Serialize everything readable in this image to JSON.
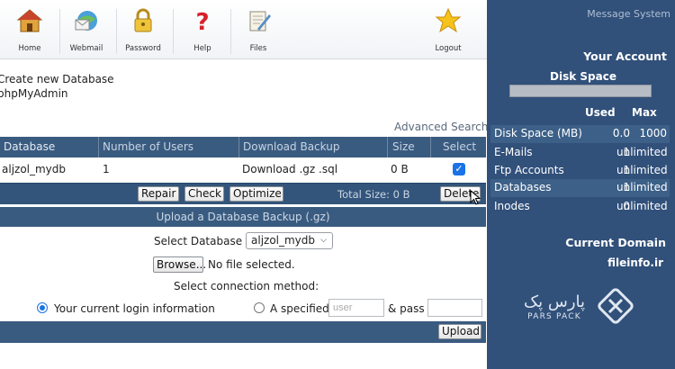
{
  "toolbar": {
    "items": [
      {
        "label": "Home",
        "icon": "home-icon"
      },
      {
        "label": "Webmail",
        "icon": "webmail-icon"
      },
      {
        "label": "Password",
        "icon": "lock-icon"
      },
      {
        "label": "Help",
        "icon": "help-icon"
      },
      {
        "label": "Files",
        "icon": "files-icon"
      },
      {
        "label": "Logout",
        "icon": "star-icon"
      }
    ]
  },
  "links": {
    "create_db": "Create new Database",
    "phpmyadmin": "phpMyAdmin",
    "advanced_search": "Advanced Search"
  },
  "table": {
    "headers": [
      "Database",
      "Number of Users",
      "Download Backup",
      "Size",
      "Select"
    ],
    "rows": [
      {
        "database": "aljzol_mydb",
        "users": "1",
        "download": "Download .gz .sql",
        "size": "0 B",
        "selected": true
      }
    ]
  },
  "actions": {
    "repair": "Repair",
    "check": "Check",
    "optimize": "Optimize",
    "total_size": "Total Size: 0 B",
    "delete": "Delete"
  },
  "upload": {
    "title": "Upload a Database Backup (.gz)",
    "select_db_label": "Select Database",
    "select_db_value": "aljzol_mydb",
    "browse": "Browse...",
    "no_file": "No file selected.",
    "method_label": "Select connection method:",
    "current_login": "Your current login information",
    "specified": "A specified",
    "user_placeholder": "user",
    "pass_label": "& pass",
    "submit": "Upload"
  },
  "panel": {
    "message_system": "Message System",
    "your_account": "Your Account",
    "disk_space": "Disk Space",
    "disk_fill": 0.0,
    "col_used": "Used",
    "col_max": "Max",
    "stats": [
      {
        "label": "Disk Space (MB)",
        "used": "0.0",
        "max": "1000"
      },
      {
        "label": "E-Mails",
        "used": "1",
        "max": "unlimited"
      },
      {
        "label": "Ftp Accounts",
        "used": "1",
        "max": "unlimited"
      },
      {
        "label": "Databases",
        "used": "1",
        "max": "unlimited"
      },
      {
        "label": "Inodes",
        "used": "0",
        "max": "unlimited"
      }
    ],
    "current_domain": "Current Domain",
    "domain": "fileinfo.ir"
  },
  "watermark": {
    "fa": "پارس پک",
    "en": "PARS PACK"
  },
  "colors": {
    "panel_bg": "#31507a",
    "header_bar": "#3a5b80",
    "accent": "#1a73e8"
  }
}
